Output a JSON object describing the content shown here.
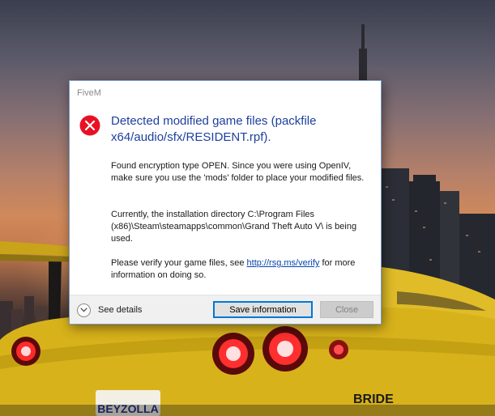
{
  "window": {
    "title": "FiveM"
  },
  "dialog": {
    "heading": "Detected modified game files (packfile x64/audio/sfx/RESIDENT.rpf).",
    "paragraph1": "Found encryption type OPEN. Since you were using OpenIV, make sure you use the 'mods' folder to place your modified files.",
    "paragraph2": "Currently, the installation directory C:\\Program Files (x86)\\Steam\\steamapps\\common\\Grand Theft Auto V\\ is being used.",
    "paragraph3_before": "Please verify your game files, see ",
    "paragraph3_link": "http://rsg.ms/verify",
    "paragraph3_after": " for more information on doing so.",
    "icon": "error-icon",
    "accent_color": "#1d3f9e",
    "error_color": "#e81123"
  },
  "footer": {
    "see_details_label": "See details",
    "save_button_label": "Save information",
    "close_button_label": "Close"
  },
  "background": {
    "car_plate_text": "BEYZOLLA",
    "car_badge_text": "BRIDE"
  }
}
